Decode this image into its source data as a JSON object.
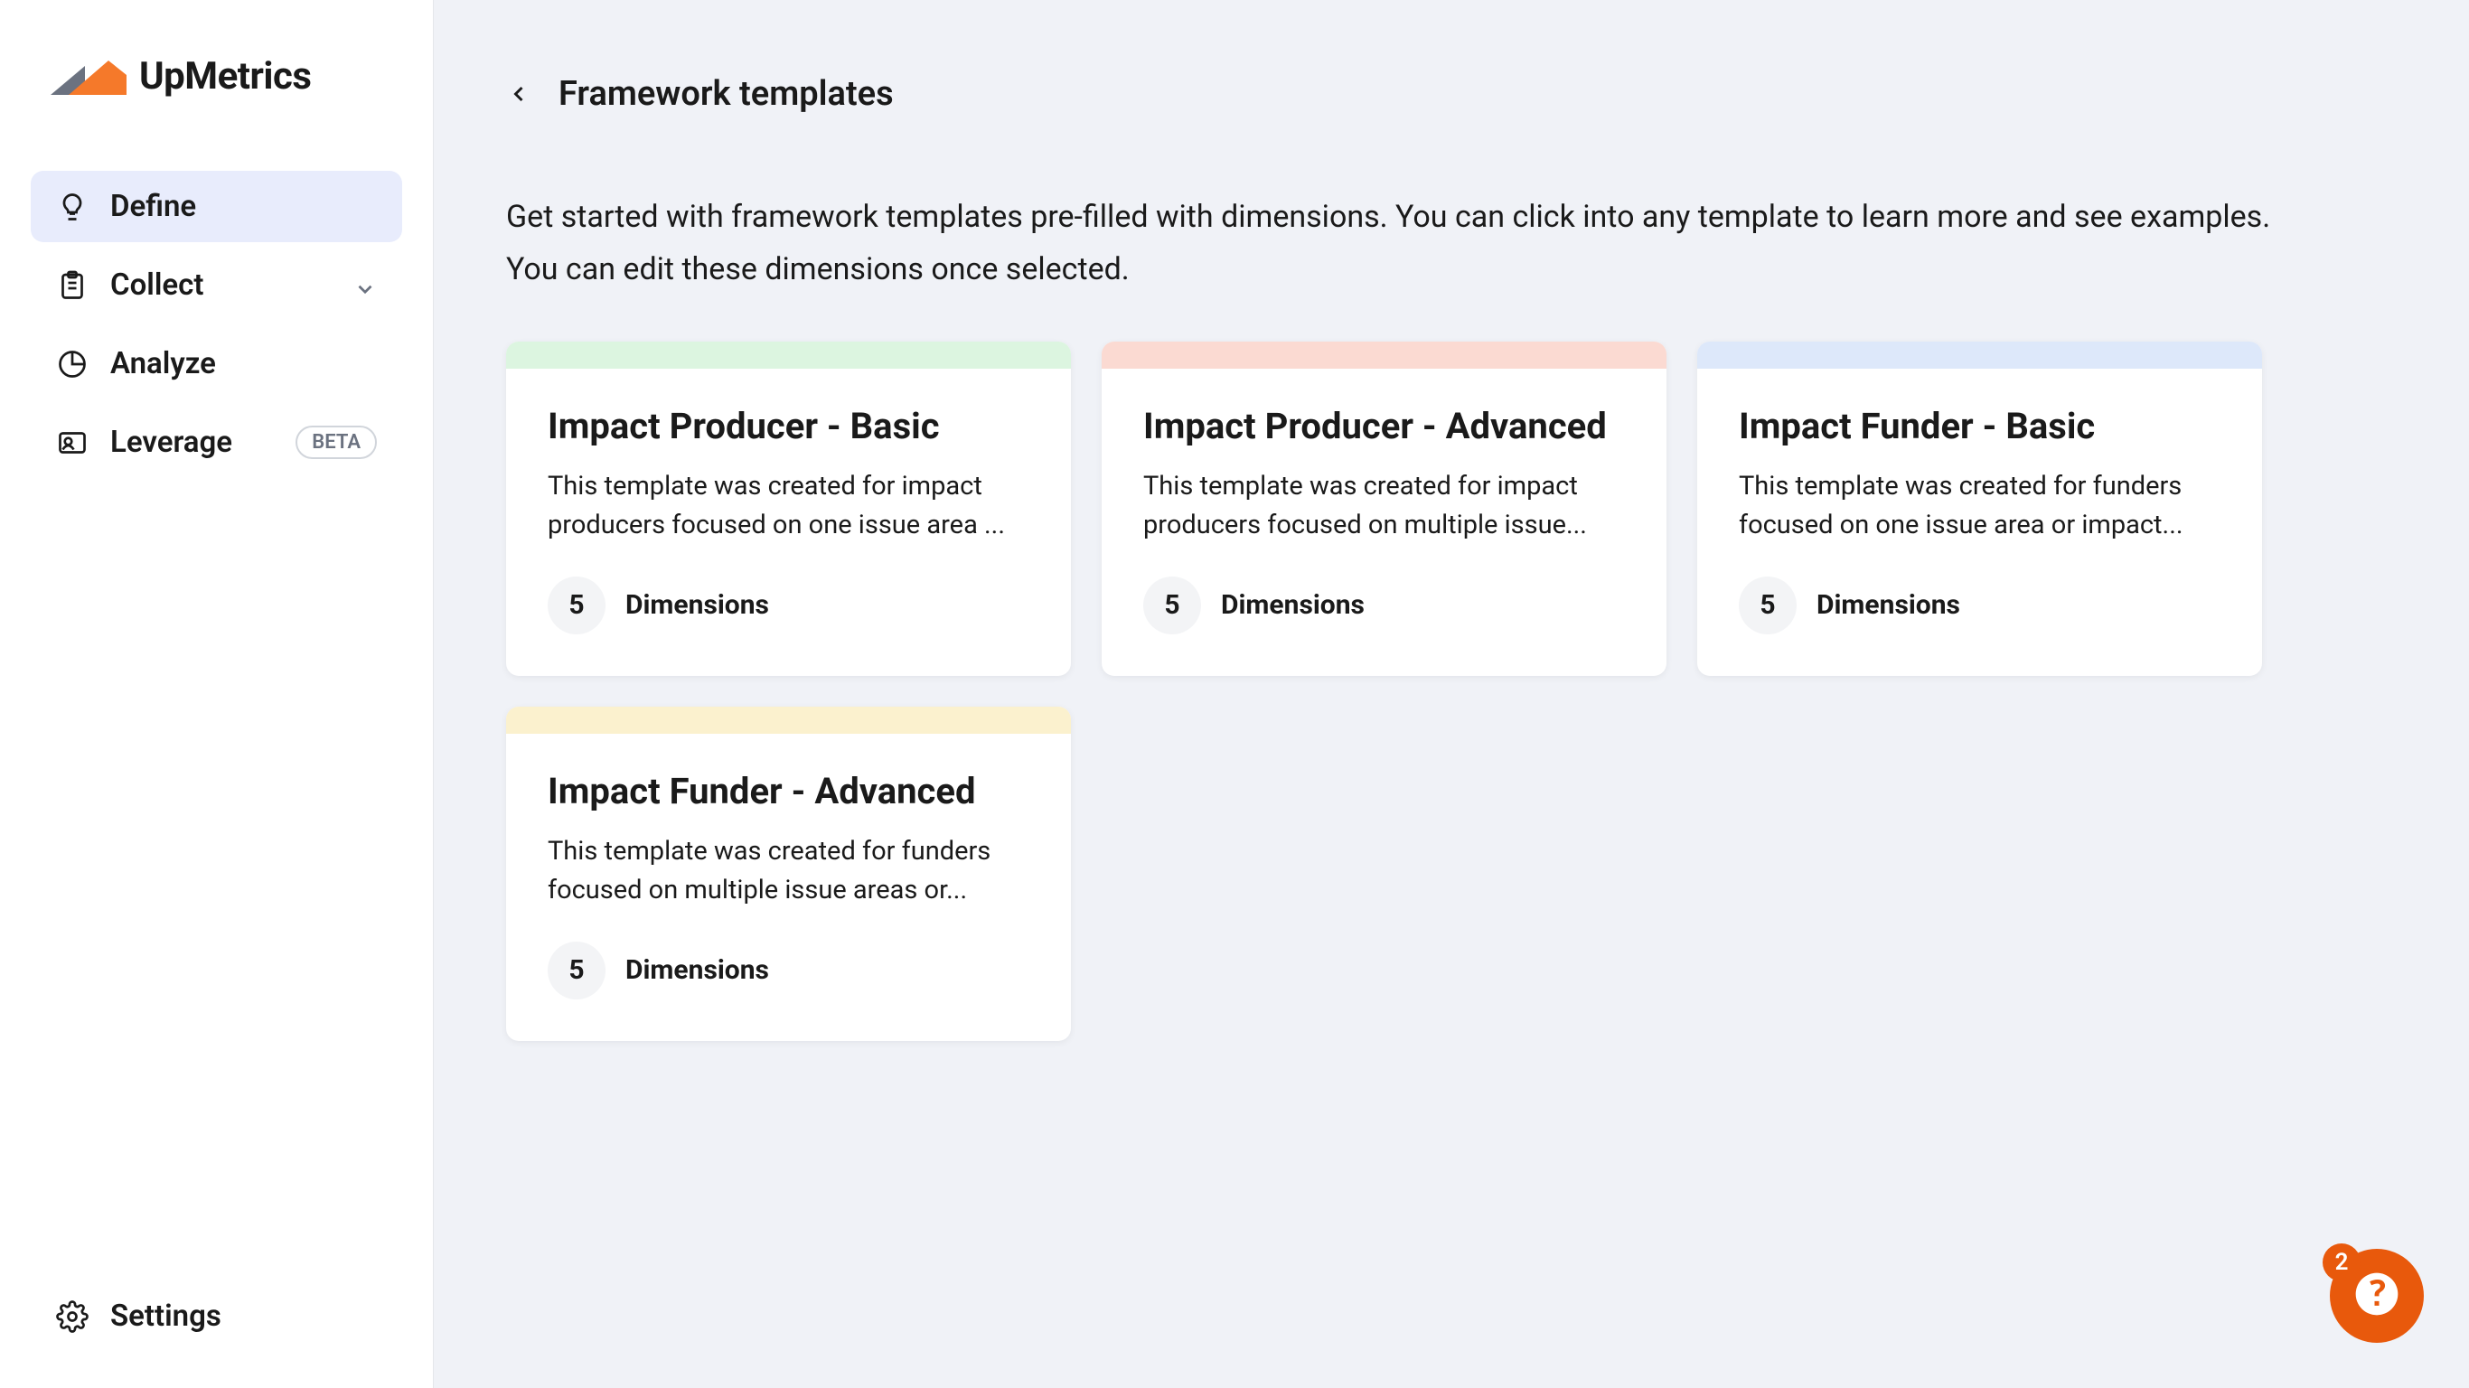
{
  "brand": {
    "name": "UpMetrics"
  },
  "sidebar": {
    "items": [
      {
        "label": "Define",
        "icon": "lightbulb",
        "active": true
      },
      {
        "label": "Collect",
        "icon": "clipboard",
        "expandable": true
      },
      {
        "label": "Analyze",
        "icon": "piechart"
      },
      {
        "label": "Leverage",
        "icon": "person-card",
        "badge": "BETA"
      }
    ],
    "settings_label": "Settings"
  },
  "header": {
    "title": "Framework templates"
  },
  "intro": "Get started with framework templates pre-filled with dimensions. You can click into any template to learn more and see examples. You can edit these dimensions once selected.",
  "dimensions_label": "Dimensions",
  "templates": [
    {
      "title": "Impact Producer - Basic",
      "description": "This template was created for impact producers focused on one issue area ...",
      "count": "5",
      "accent": "#dcf5e0"
    },
    {
      "title": "Impact Producer - Advanced",
      "description": "This template was created for impact producers focused on multiple issue...",
      "count": "5",
      "accent": "#fbdad2"
    },
    {
      "title": "Impact Funder - Basic",
      "description": "This template was created for funders focused on one issue area or impact...",
      "count": "5",
      "accent": "#dde8fa"
    },
    {
      "title": "Impact Funder - Advanced",
      "description": "This template was created for funders focused on multiple issue areas or...",
      "count": "5",
      "accent": "#fbf1ce"
    }
  ],
  "help": {
    "badge": "2"
  }
}
